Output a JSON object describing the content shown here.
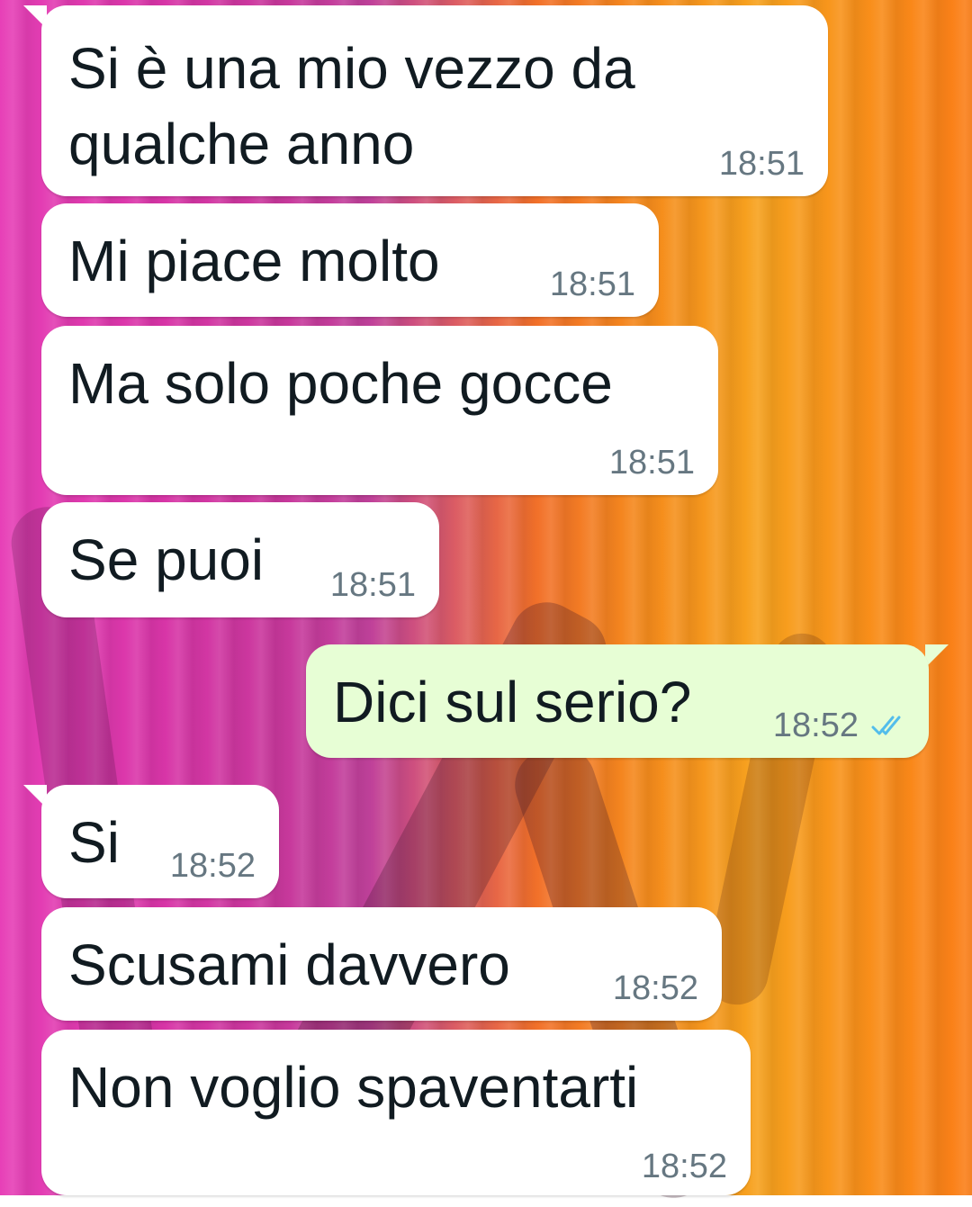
{
  "messages": [
    {
      "direction": "incoming",
      "text": "Si è una mio vezzo da\nqualche anno",
      "time": "18:51"
    },
    {
      "direction": "incoming",
      "text": "Mi piace molto",
      "time": "18:51"
    },
    {
      "direction": "incoming",
      "text": "Ma solo poche gocce",
      "time": "18:51"
    },
    {
      "direction": "incoming",
      "text": "Se puoi",
      "time": "18:51"
    },
    {
      "direction": "outgoing",
      "text": "Dici sul serio?",
      "time": "18:52",
      "status": "read"
    },
    {
      "direction": "incoming",
      "text": "Si",
      "time": "18:52"
    },
    {
      "direction": "incoming",
      "text": "Scusami davvero",
      "time": "18:52"
    },
    {
      "direction": "incoming",
      "text": "Non voglio spaventarti",
      "time": "18:52"
    }
  ],
  "colors": {
    "incoming_bubble": "#ffffff",
    "outgoing_bubble": "#e7fed5",
    "text": "#111b21",
    "timestamp": "#667781",
    "read_ticks": "#53bdeb"
  },
  "icons": {
    "read_receipt": "double-check-icon"
  }
}
